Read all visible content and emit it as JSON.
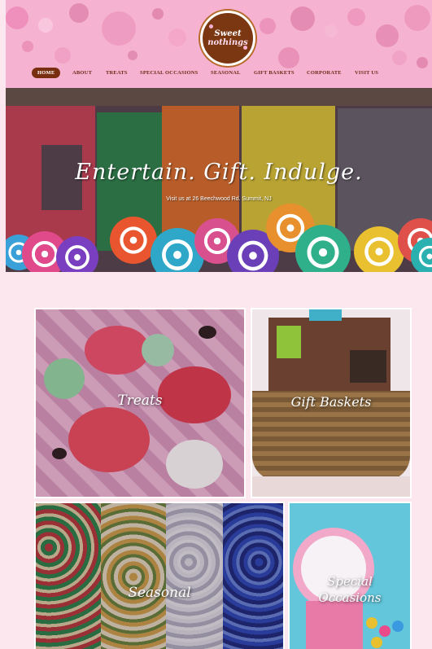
{
  "brand": {
    "logo_line1": "Sweet",
    "logo_line2": "nothings"
  },
  "nav": {
    "items": [
      {
        "label": "HOME",
        "active": true
      },
      {
        "label": "ABOUT"
      },
      {
        "label": "TREATS"
      },
      {
        "label": "SPECIAL OCCASIONS"
      },
      {
        "label": "SEASONAL"
      },
      {
        "label": "GIFT BASKETS"
      },
      {
        "label": "CORPORATE"
      },
      {
        "label": "VISIT US"
      }
    ]
  },
  "hero": {
    "title": "Entertain. Gift. Indulge.",
    "subtitle": "Visit us at 26 Beechwood Rd. Summit, NJ"
  },
  "tiles": {
    "treats": "Treats",
    "gift_baskets": "Gift Baskets",
    "seasonal": "Seasonal",
    "special_line1": "Special",
    "special_line2": "Occasions"
  },
  "colors": {
    "header_pink": "#f6b3d1",
    "nav_brown": "#7a2e10",
    "page_bg": "#fde7ef"
  }
}
